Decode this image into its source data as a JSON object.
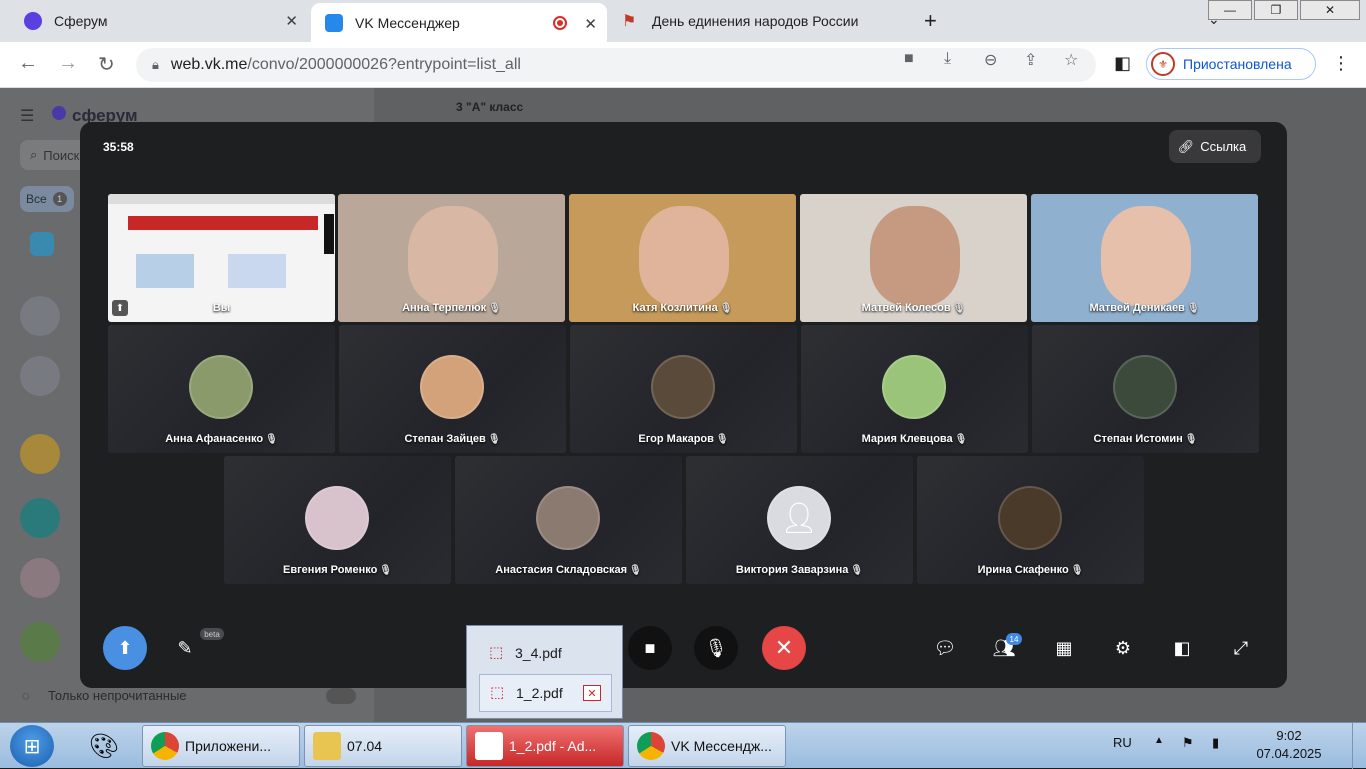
{
  "browser": {
    "tabs": [
      {
        "title": "Сферум",
        "color": "#5b3fe0",
        "active": false
      },
      {
        "title": "VK Мессенджер",
        "color": "#2688eb",
        "active": true
      },
      {
        "title": "День единения народов России",
        "color": "#c0392b",
        "active": false
      }
    ],
    "url_host": "web.vk.me",
    "url_path": "/convo/2000000026?entrypoint=list_all",
    "profile_label": "Приостановлена"
  },
  "sidebar": {
    "brand": "сферум",
    "search_placeholder": "Поиск",
    "filter_all": "Все",
    "filter_count": "1",
    "only_unread": "Только непрочитанные",
    "chat_title": "3 \"А\" класс"
  },
  "call": {
    "timer": "35:58",
    "link_label": "Ссылка",
    "participants": [
      {
        "name": "Вы",
        "type": "screen"
      },
      {
        "name": "Анна Терпелюк",
        "type": "video",
        "bg": "#b9a79a"
      },
      {
        "name": "Катя Козлитина",
        "type": "video",
        "bg": "#c59a5a"
      },
      {
        "name": "Матвей Колесов",
        "type": "video",
        "bg": "#d8d2cb"
      },
      {
        "name": "Матвей Деникаев",
        "type": "video",
        "bg": "#8fb0cf"
      },
      {
        "name": "Анна Афанасенко",
        "type": "avatar",
        "avatar": "#8a9a6a"
      },
      {
        "name": "Степан Зайцев",
        "type": "avatar",
        "avatar": "#d3a27a"
      },
      {
        "name": "Егор Макаров",
        "type": "avatar",
        "avatar": "#5a4a3a"
      },
      {
        "name": "Мария Клевцова",
        "type": "avatar",
        "avatar": "#9ac47a"
      },
      {
        "name": "Степан Истомин",
        "type": "avatar",
        "avatar": "#3b4a3a"
      },
      {
        "name": "Евгения Роменко",
        "type": "avatar",
        "avatar": "#d8c2cc"
      },
      {
        "name": "Анастасия Складовская",
        "type": "avatar",
        "avatar": "#8a7a70"
      },
      {
        "name": "Виктория Заварзина",
        "type": "placeholder",
        "avatar": "#d9dbe0"
      },
      {
        "name": "Ирина Скафенко",
        "type": "avatar",
        "avatar": "#4a3a2a"
      }
    ],
    "participants_count": "14",
    "beta_label": "beta"
  },
  "popup": {
    "items": [
      "3_4.pdf",
      "1_2.pdf"
    ]
  },
  "taskbar": {
    "items": [
      "Приложени...",
      "07.04",
      "1_2.pdf - Ad...",
      "VK Мессендж..."
    ],
    "lang": "RU",
    "time": "9:02",
    "date": "07.04.2025"
  }
}
